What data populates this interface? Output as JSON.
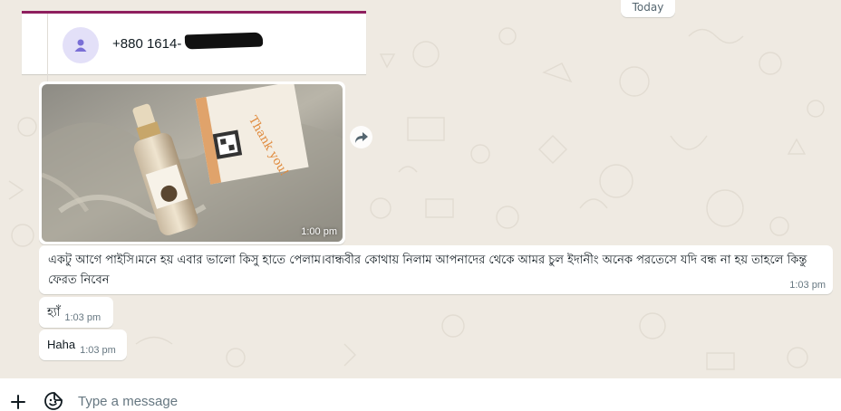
{
  "chat": {
    "date_chip": "Today",
    "contact_card": {
      "phone_number": "+880 1614-"
    },
    "image_message": {
      "time": "1:00 pm"
    },
    "messages": [
      {
        "text": "একটু আগে পাইসি।মনে হয় এবার ভালো কিসু হাতে পেলাম।বান্ধবীর কোথায় নিলাম আপনাদের থেকে আমর চুল ইদানীং অনেক পরতেসে যদি বন্ধ না হয় তাহলে কিন্তু ফেরত নিবেন",
        "time": "1:03 pm"
      },
      {
        "text": "হ্যাঁ",
        "time": "1:03 pm"
      },
      {
        "text": "Haha",
        "time": "1:03 pm"
      }
    ]
  },
  "composer": {
    "placeholder": "Type a message"
  },
  "icons": {
    "forward": "forward-arrow-icon",
    "plus": "plus-icon",
    "emoji": "emoji-sticker-icon",
    "avatar": "person-icon"
  },
  "colors": {
    "chat_background": "#efeae2",
    "card_accent": "#8e1f5e",
    "avatar_bg": "#e3e0f8",
    "avatar_fg": "#7a6fd6"
  }
}
